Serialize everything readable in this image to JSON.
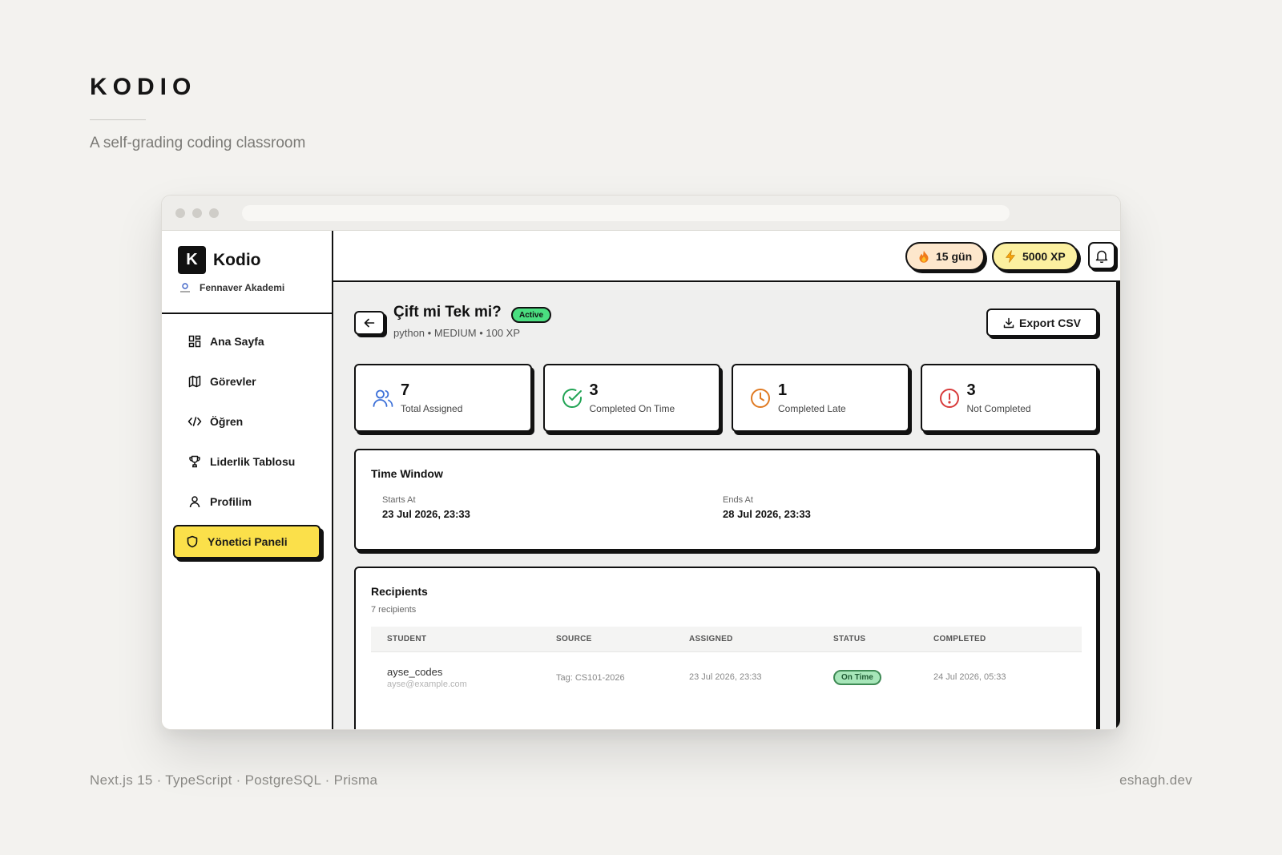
{
  "presentation": {
    "brand": "KODIO",
    "tagline": "A self-grading coding classroom",
    "footer_tech": "Next.js 15 · TypeScript · PostgreSQL · Prisma",
    "footer_site": "eshagh.dev"
  },
  "sidebar": {
    "logo_letter": "K",
    "app_name": "Kodio",
    "org_name": "Fennaver Akademi",
    "items": [
      {
        "label": "Ana Sayfa",
        "icon": "grid-icon"
      },
      {
        "label": "Görevler",
        "icon": "map-icon"
      },
      {
        "label": "Öğren",
        "icon": "code-icon"
      },
      {
        "label": "Liderlik Tablosu",
        "icon": "trophy-icon"
      },
      {
        "label": "Profilim",
        "icon": "user-icon"
      },
      {
        "label": "Yönetici Paneli",
        "icon": "shield-icon",
        "active": true
      }
    ]
  },
  "topbar": {
    "streak": "15 gün",
    "xp": "5000 XP"
  },
  "assignment": {
    "title": "Çift mi Tek mi?",
    "status": "Active",
    "language": "python",
    "difficulty": "MEDIUM",
    "points": "100 XP",
    "export_label": "Export CSV"
  },
  "stats": [
    {
      "value": "7",
      "label": "Total Assigned",
      "icon": "users-icon",
      "color": "#3b6fd8"
    },
    {
      "value": "3",
      "label": "Completed On Time",
      "icon": "check-circle-icon",
      "color": "#22a455"
    },
    {
      "value": "1",
      "label": "Completed Late",
      "icon": "clock-icon",
      "color": "#e07a22"
    },
    {
      "value": "3",
      "label": "Not Completed",
      "icon": "alert-circle-icon",
      "color": "#d83a3a"
    }
  ],
  "time_window": {
    "title": "Time Window",
    "starts_label": "Starts At",
    "starts_value": "23 Jul 2026, 23:33",
    "ends_label": "Ends At",
    "ends_value": "28 Jul 2026, 23:33"
  },
  "recipients": {
    "title": "Recipients",
    "count": "7 recipients",
    "columns": [
      "STUDENT",
      "SOURCE",
      "ASSIGNED",
      "STATUS",
      "COMPLETED"
    ],
    "rows": [
      {
        "student": "ayse_codes",
        "email": "ayse@example.com",
        "source": "Tag: CS101-2026",
        "assigned": "23 Jul 2026, 23:33",
        "status": "On Time",
        "completed": "24 Jul 2026, 05:33"
      }
    ]
  },
  "colors": {
    "accent_yellow": "#fbe04a",
    "active_green": "#4ade80",
    "border": "#111111"
  }
}
